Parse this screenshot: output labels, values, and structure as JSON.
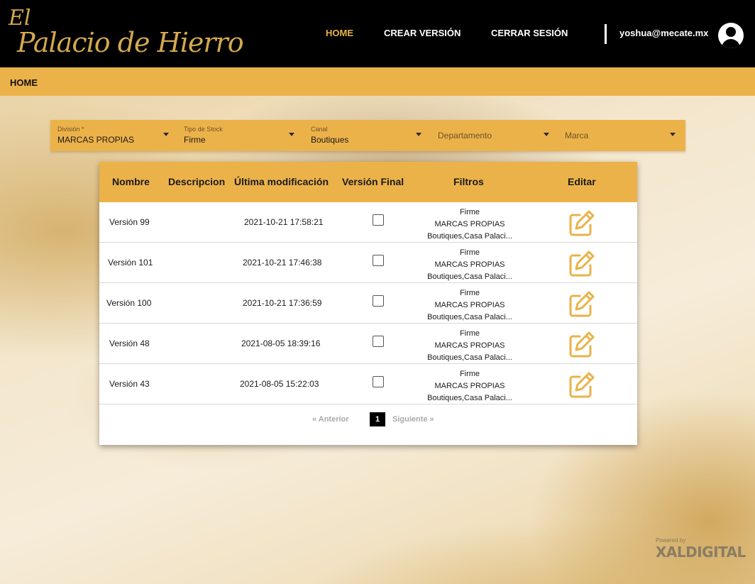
{
  "header": {
    "logo_top": "El",
    "logo_main": "Palacio de Hierro",
    "nav": [
      {
        "label": "HOME",
        "active": true
      },
      {
        "label": "CREAR VERSIÓN",
        "active": false
      },
      {
        "label": "CERRAR SESIÓN",
        "active": false
      }
    ],
    "user_email": "yoshua@mecate.mx",
    "avatar_icon": "account-circle-icon"
  },
  "breadcrumb": "HOME",
  "filters": [
    {
      "label": "División *",
      "value": "MARCAS PROPIAS"
    },
    {
      "label": "Tipo de Stock",
      "value": "Firme"
    },
    {
      "label": "Canal",
      "value": "Boutiques"
    },
    {
      "label": "",
      "placeholder": "Departamento"
    },
    {
      "label": "",
      "placeholder": "Marca"
    }
  ],
  "table": {
    "headers": [
      "Nombre",
      "Descripcion",
      "Última modificación",
      "Versión Final",
      "Filtros",
      "Editar"
    ],
    "rows": [
      {
        "nombre": "Versión 99",
        "descripcion": "",
        "modificacion": "2021-10-21 17:58:21",
        "final": false,
        "filtros": [
          "Firme",
          "MARCAS PROPIAS",
          "Boutiques,Casa Palaci..."
        ]
      },
      {
        "nombre": "Versión 101",
        "descripcion": "",
        "modificacion": "2021-10-21 17:46:38",
        "final": false,
        "filtros": [
          "Firme",
          "MARCAS PROPIAS",
          "Boutiques,Casa Palaci..."
        ]
      },
      {
        "nombre": "Versión 100",
        "descripcion": "",
        "modificacion": "2021-10-21 17:36:59",
        "final": false,
        "filtros": [
          "Firme",
          "MARCAS PROPIAS",
          "Boutiques,Casa Palaci..."
        ]
      },
      {
        "nombre": "Versión 48",
        "descripcion": "",
        "modificacion": "2021-08-05 18:39:16",
        "final": false,
        "filtros": [
          "Firme",
          "MARCAS PROPIAS",
          "Boutiques,Casa Palaci..."
        ]
      },
      {
        "nombre": "Versión 43",
        "descripcion": "",
        "modificacion": "2021-08-05 15:22:03",
        "final": false,
        "filtros": [
          "Firme",
          "MARCAS PROPIAS",
          "Boutiques,Casa Palaci..."
        ]
      }
    ]
  },
  "pagination": {
    "prev": "« Anterior",
    "current": "1",
    "next": "Siguiente »"
  },
  "footer": {
    "powered_by": "Powered by",
    "brand": "XALDIGITAL"
  },
  "colors": {
    "accent": "#ecb24a",
    "header_bg": "#000000",
    "edit_icon": "#e8b34a"
  }
}
